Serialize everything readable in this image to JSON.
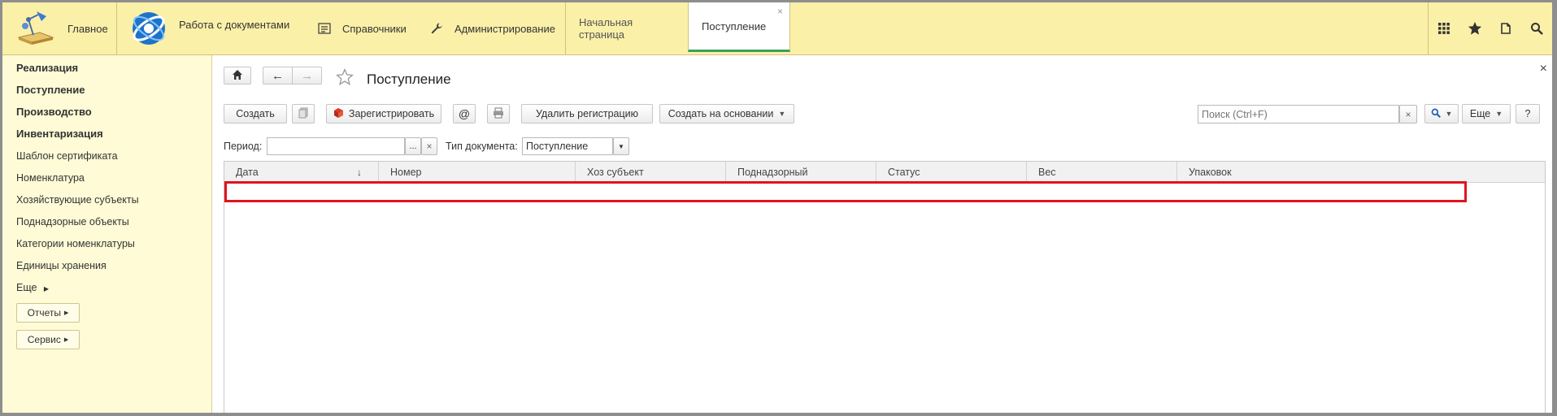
{
  "topbar": {
    "main_label": "Главное",
    "docs_label": "Работа с документами",
    "refs_label": "Справочники",
    "admin_label": "Администрирование",
    "tabs": [
      {
        "label": "Начальная страница"
      },
      {
        "label": "Поступление",
        "close": "×"
      }
    ],
    "icons": [
      "apps-grid-icon",
      "star-icon",
      "history-icon",
      "search-icon"
    ]
  },
  "sidebar": {
    "items": [
      {
        "label": "Реализация",
        "bold": true
      },
      {
        "label": "Поступление",
        "bold": true
      },
      {
        "label": "Производство",
        "bold": true
      },
      {
        "label": "Инвентаризация",
        "bold": true
      },
      {
        "label": "Шаблон сертификата"
      },
      {
        "label": "Номенклатура"
      },
      {
        "label": "Хозяйствующие субъекты"
      },
      {
        "label": "Поднадзорные объекты"
      },
      {
        "label": "Категории номенклатуры"
      },
      {
        "label": "Единицы хранения"
      },
      {
        "label": "Еще"
      }
    ],
    "reports_label": "Отчеты",
    "service_label": "Сервис"
  },
  "form": {
    "title": "Поступление",
    "close": "×",
    "toolbar": {
      "create": "Создать",
      "register": "Зарегистрировать",
      "at": "@",
      "unregister": "Удалить регистрацию",
      "create_based": "Создать на основании",
      "more": "Еще",
      "help": "?"
    },
    "search": {
      "placeholder": "Поиск (Ctrl+F)",
      "clear": "×"
    },
    "filters": {
      "period_label": "Период:",
      "period_value": "",
      "period_dots": "...",
      "period_clear": "×",
      "doctype_label": "Тип документа:",
      "doctype_value": "Поступление"
    },
    "table": {
      "columns": [
        "Дата",
        "Номер",
        "Хоз субъект",
        "Поднадзорный",
        "Статус",
        "Вес",
        "Упаковок"
      ],
      "sort_indicator": "↓",
      "rows": []
    }
  },
  "colors": {
    "topbar_bg": "#fbf0a8",
    "sidebar_bg": "#fefbd6",
    "active_tab_underline": "#3aa05a",
    "highlight": "#e0141e"
  }
}
